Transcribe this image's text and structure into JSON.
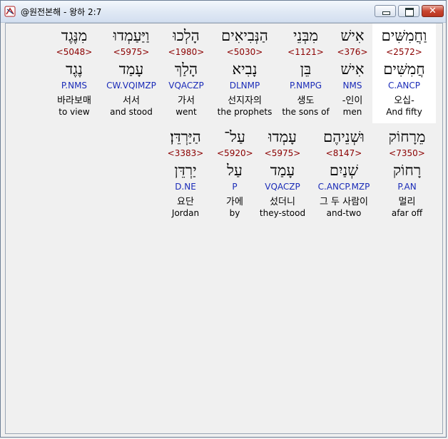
{
  "window": {
    "title": "@원전본해 - 왕하 2:7"
  },
  "words": [
    {
      "hebrew": "וַחֲמִשִּׁים",
      "strong": "<2572>",
      "lemma": "חֲמִשִּׁים",
      "morph": "C.ANCP",
      "korean": "오십-",
      "english": "And fifty",
      "selected": true
    },
    {
      "hebrew": "אִישׁ",
      "strong": "<376>",
      "lemma": "אִישׁ",
      "morph": "NMS",
      "korean": "-인이",
      "english": "men"
    },
    {
      "hebrew": "מִבְּנֵי",
      "strong": "<1121>",
      "lemma": "בֵּן",
      "morph": "P.NMPG",
      "korean": "생도",
      "english": "the sons of"
    },
    {
      "hebrew": "הַנְּבִיאִים",
      "strong": "<5030>",
      "lemma": "נָבִיא",
      "morph": "DLNMP",
      "korean": "선지자의",
      "english": "the prophets"
    },
    {
      "hebrew": "הָלְכוּ",
      "strong": "<1980>",
      "lemma": "הָלַךְ",
      "morph": "VQACZP",
      "korean": "가서",
      "english": "went"
    },
    {
      "hebrew": "וַיַּעַמְדוּ",
      "strong": "<5975>",
      "lemma": "עָמַד",
      "morph": "CW.VQIMZP",
      "korean": "서서",
      "english": "and stood"
    },
    {
      "hebrew": "מִנֶּגֶד",
      "strong": "<5048>",
      "lemma": "נֶגֶד",
      "morph": "P.NMS",
      "korean": "바라보매",
      "english": "to view"
    },
    {
      "hebrew": "מֵרָחוֹק",
      "strong": "<7350>",
      "lemma": "רָחוֹק",
      "morph": "P.AN",
      "korean": "멀리",
      "english": "afar off"
    },
    {
      "hebrew": "וּשְׁנֵיהֶם",
      "strong": "<8147>",
      "lemma": "שְׁנַיִם",
      "morph": "C.ANCP.MZP",
      "korean": "그 두 사람이",
      "english": "and-two"
    },
    {
      "hebrew": "עָמְדוּ",
      "strong": "<5975>",
      "lemma": "עָמַד",
      "morph": "VQACZP",
      "korean": "섰더니",
      "english": "they-stood"
    },
    {
      "hebrew": "עַל־",
      "strong": "<5920>",
      "lemma": "עַל",
      "morph": "P",
      "korean": "가에",
      "english": "by"
    },
    {
      "hebrew": "הַיַּרְדֵּן׃",
      "strong": "<3383>",
      "lemma": "יַרְדֵּן",
      "morph": "D.NE",
      "korean": "요단",
      "english": "Jordan"
    }
  ]
}
